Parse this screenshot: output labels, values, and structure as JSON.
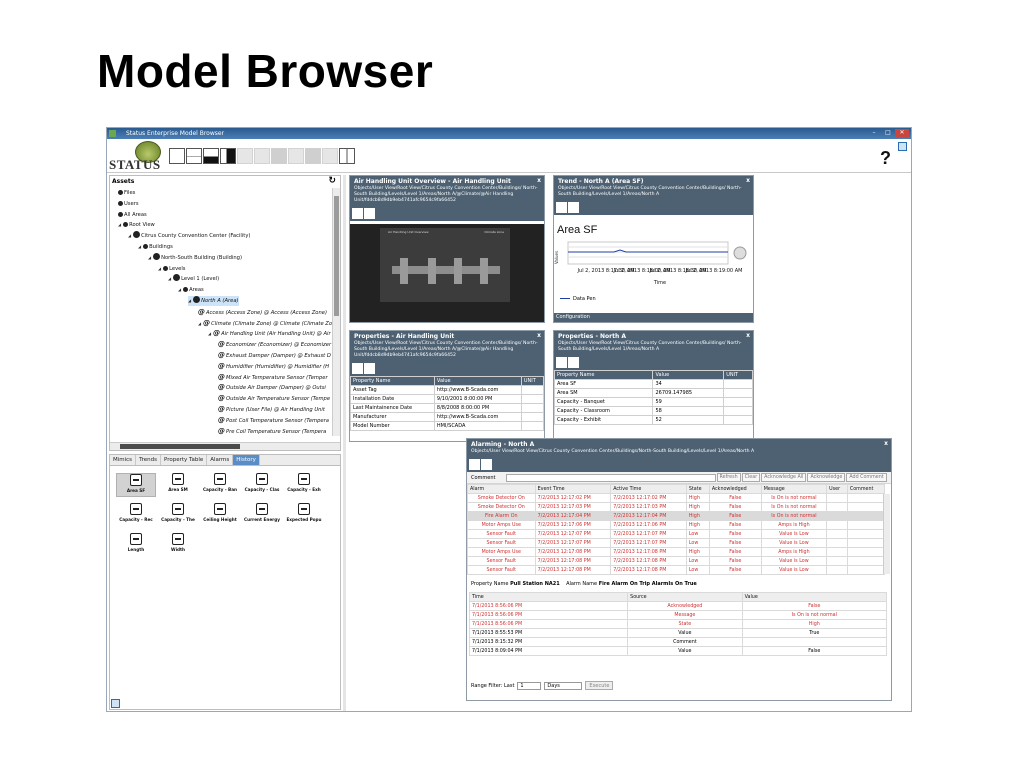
{
  "slide": {
    "title": "Model Browser"
  },
  "window": {
    "title": "Status Enterprise Model Browser",
    "help": "?"
  },
  "logo": {
    "text": "STATUS"
  },
  "assets": {
    "header": "Assets",
    "tree": [
      {
        "label": "Files"
      },
      {
        "label": "Users"
      },
      {
        "label": "All Areas"
      },
      {
        "label": "Root View"
      },
      {
        "label": "Citrus County Convention Center (Facility)"
      },
      {
        "label": "Buildings"
      },
      {
        "label": "North-South Building (Building)"
      },
      {
        "label": "Levels"
      },
      {
        "label": "Level 1 (Level)"
      },
      {
        "label": "Areas"
      },
      {
        "label": "North A (Area)"
      },
      {
        "label": "Access (Access Zone) @ Access (Access Zone)"
      },
      {
        "label": "Climate (Climate Zone) @ Climate (Climate Zo"
      },
      {
        "label": "Air Handling Unit (Air Handling Unit) @ Air"
      },
      {
        "label": "Economizer (Economizer) @ Economizer"
      },
      {
        "label": "Exhaust Damper (Damper) @ Exhaust D"
      },
      {
        "label": "Humidifier (Humidifier) @ Humidifier (H"
      },
      {
        "label": "Mixed Air Temperature Sensor (Temper"
      },
      {
        "label": "Outside Air Damper (Damper) @ Outsi"
      },
      {
        "label": "Outside Air Temperature Sensor (Tempe"
      },
      {
        "label": "Picture (User File) @ Air Handling Unit"
      },
      {
        "label": "Post Coil Temperature Sensor (Tempera"
      },
      {
        "label": "Pre Coil Temperature Sensor (Tempera"
      }
    ]
  },
  "bottom_tabs": {
    "tabs": [
      "Mimics",
      "Trends",
      "Property Table",
      "Alarms",
      "History"
    ],
    "items": [
      "Area SF",
      "Area SM",
      "Capacity - Ban",
      "Capacity - Clas",
      "Capacity - Exh",
      "Capacity - Rec",
      "Capacity - The",
      "Ceiling Height",
      "Current Energy",
      "Expected Popu",
      "Length",
      "Width"
    ]
  },
  "panels": {
    "ahu_overview": {
      "title": "Air Handling Unit Overview - Air Handling Unit",
      "path": "Objects/User View/Root View/Citrus County Convention Center/Buildings/ North-South Building/Levels/Level 1/Areas/North A/@Climate/@Air Handling Unit/fddcb8d9db9eb4741afc9654c9fa66452",
      "mimic_title": "Air Handling Unit Overview",
      "mimic_subtitle": "Climate zone"
    },
    "trend": {
      "title": "Trend - North A (Area SF)",
      "path": "Objects/User View/Root View/Citrus County Convention Center/Buildings/ North-South Building/Levels/Level 1/Areas/North A",
      "chart_title": "Area SF",
      "y_label": "Values",
      "ticks": [
        "Jul 2, 2013 8:17:30 AM",
        "Jul 2, 2013 8:18:00 AM",
        "Jul 2, 2013 8:18:30 AM",
        "Jul 2, 2013 8:19:00 AM"
      ],
      "x_label": "Time",
      "legend": "Data Pen",
      "footer": "Configuration"
    },
    "props_ahu": {
      "title": "Properties - Air Handling Unit",
      "path": "Objects/User View/Root View/Citrus County Convention Center/Buildings/ North-South Building/Levels/Level 1/Areas/North A/@Climate/@Air Handling Unit/fddcb8d9db9eb4741afc9654c9fa66452",
      "columns": [
        "Property Name",
        "Value",
        "UNIT"
      ],
      "rows": [
        [
          "Asset Tag",
          "http://www.B-Scada.com",
          ""
        ],
        [
          "Installation Date",
          "9/10/2001 8:00:00 PM",
          ""
        ],
        [
          "Last Maintainence Date",
          "8/8/2008 8:00:00 PM",
          ""
        ],
        [
          "Manufacturer",
          "http://www.B-Scada.com",
          ""
        ],
        [
          "Model Number",
          "HMI/SCADA",
          ""
        ]
      ]
    },
    "props_north": {
      "title": "Properties - North A",
      "path": "Objects/User View/Root View/Citrus County Convention Center/Buildings/ North-South Building/Levels/Level 1/Areas/North A",
      "columns": [
        "Property Name",
        "Value",
        "UNIT"
      ],
      "rows": [
        [
          "Area SF",
          "34",
          ""
        ],
        [
          "Area SM",
          "26709.147985",
          ""
        ],
        [
          "Capacity - Banquet",
          "59",
          ""
        ],
        [
          "Capacity - Classroom",
          "58",
          ""
        ],
        [
          "Capacity - Exhibit",
          "52",
          ""
        ]
      ]
    },
    "alarming": {
      "title": "Alarming - North A",
      "path": "Objects/User View/Root View/Citrus County Convention Center/Buildings/North-South Building/Levels/Level 1/Areas/North A",
      "comment_label": "Comment",
      "buttons": [
        "Refresh",
        "Clear",
        "Acknowledge All",
        "Acknowledge",
        "Add Comment"
      ],
      "columns": [
        "Alarm",
        "Event Time",
        "Active Time",
        "State",
        "Acknowledged",
        "Message",
        "User",
        "Comment"
      ],
      "rows": [
        [
          "Smoke Detector On",
          "7/2/2013 12:17:02 PM",
          "7/2/2013 12:17:02 PM",
          "High",
          "False",
          "Is On is not normal",
          "",
          ""
        ],
        [
          "Smoke Detector On",
          "7/2/2013 12:17:03 PM",
          "7/2/2013 12:17:03 PM",
          "High",
          "False",
          "Is On is not normal",
          "",
          ""
        ],
        [
          "Fire Alarm On",
          "7/2/2013 12:17:04 PM",
          "7/2/2013 12:17:04 PM",
          "High",
          "False",
          "Is On is not normal",
          "",
          ""
        ],
        [
          "Motor Amps Use",
          "7/2/2013 12:17:06 PM",
          "7/2/2013 12:17:06 PM",
          "High",
          "False",
          "Amps is High",
          "",
          ""
        ],
        [
          "Sensor Fault",
          "7/2/2013 12:17:07 PM",
          "7/2/2013 12:17:07 PM",
          "Low",
          "False",
          "Value is Low",
          "",
          ""
        ],
        [
          "Sensor Fault",
          "7/2/2013 12:17:07 PM",
          "7/2/2013 12:17:07 PM",
          "Low",
          "False",
          "Value is Low",
          "",
          ""
        ],
        [
          "Motor Amps Use",
          "7/2/2013 12:17:08 PM",
          "7/2/2013 12:17:08 PM",
          "High",
          "False",
          "Amps is High",
          "",
          ""
        ],
        [
          "Sensor Fault",
          "7/2/2013 12:17:08 PM",
          "7/2/2013 12:17:08 PM",
          "Low",
          "False",
          "Value is Low",
          "",
          ""
        ],
        [
          "Sensor Fault",
          "7/2/2013 12:17:08 PM",
          "7/2/2013 12:17:08 PM",
          "Low",
          "False",
          "Value is Low",
          "",
          ""
        ]
      ],
      "summary_property_label": "Property Name",
      "summary_property": "Pull Station NA21",
      "summary_alarm_label": "Alarm Name",
      "summary_alarm": "Fire Alarm On Trip AlarmIs On True",
      "history_columns": [
        "Time",
        "Source",
        "Value"
      ],
      "history_rows": [
        [
          "7/1/2013 8:56:06 PM",
          "Acknowledged",
          "False"
        ],
        [
          "7/1/2013 8:56:06 PM",
          "Message",
          "Is On is not normal"
        ],
        [
          "7/1/2013 8:56:06 PM",
          "State",
          "High"
        ],
        [
          "7/1/2013 8:55:53 PM",
          "Value",
          "True"
        ],
        [
          "7/1/2013 8:15:32 PM",
          "Comment",
          ""
        ],
        [
          "7/1/2013 8:09:04 PM",
          "Value",
          "False"
        ]
      ],
      "range_label": "Range Filter: Last",
      "range_value": "1",
      "range_unit": "Days",
      "execute": "Execute"
    }
  }
}
